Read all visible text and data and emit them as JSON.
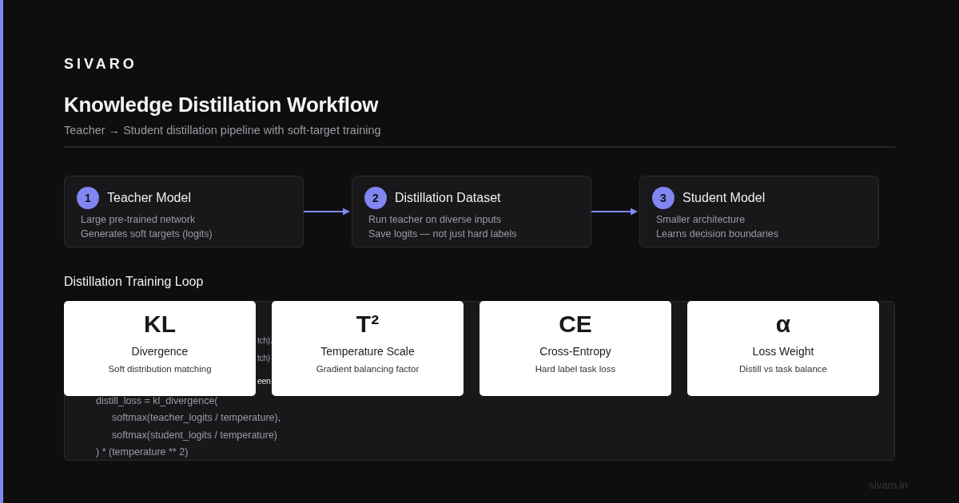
{
  "brand": "SIVARO",
  "title": "Knowledge Distillation Workflow",
  "subtitle": "Teacher → Student distillation pipeline with soft-target training",
  "pipeline": [
    {
      "number": "1",
      "title": "Teacher Model",
      "lines": [
        "Large pre-trained network",
        "Generates soft targets (logits)"
      ]
    },
    {
      "number": "2",
      "title": "Distillation Dataset",
      "lines": [
        "Run teacher on diverse inputs",
        "Save logits — not just hard labels"
      ]
    },
    {
      "number": "3",
      "title": "Student Model",
      "lines": [
        "Smaller architecture",
        "Learns decision boundaries"
      ]
    }
  ],
  "loop": {
    "heading": "Distillation Training Loop",
    "code_lines": [
      {
        "kind": "fragment",
        "text": "tch)."
      },
      {
        "kind": "fragment",
        "text": "tch)"
      },
      {
        "kind": "fragment-bright",
        "text": "een"
      },
      {
        "kind": "code",
        "text": "distill_loss = kl_divergence("
      },
      {
        "kind": "indented",
        "text": "softmax(teacher_logits / temperature),"
      },
      {
        "kind": "indented",
        "text": "softmax(student_logits / temperature)"
      },
      {
        "kind": "code",
        "text": ") * (temperature ** 2)"
      }
    ],
    "cards": [
      {
        "symbol": "KL",
        "title": "Divergence",
        "note": "Soft distribution matching"
      },
      {
        "symbol": "T²",
        "title": "Temperature Scale",
        "note": "Gradient balancing factor"
      },
      {
        "symbol": "CE",
        "title": "Cross-Entropy",
        "note": "Hard label task loss"
      },
      {
        "symbol": "α",
        "title": "Loss Weight",
        "note": "Distill vs task balance"
      }
    ]
  },
  "footer": "sivaro.in"
}
